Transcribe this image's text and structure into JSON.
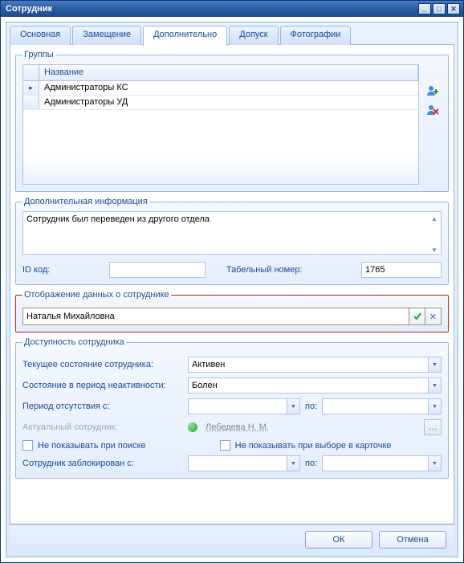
{
  "window": {
    "title": "Сотрудник"
  },
  "tabs": {
    "main": "Основная",
    "substitution": "Замещение",
    "additional": "Дополнительно",
    "access": "Допуск",
    "photos": "Фотографии"
  },
  "groups": {
    "legend": "Группы",
    "header": "Название",
    "rows": [
      "Администраторы КС",
      "Администраторы УД"
    ]
  },
  "addinfo": {
    "legend": "Дополнительная информация",
    "text": "Сотрудник был переведен из другого отдела",
    "idcode_label": "ID код:",
    "idcode_value": "",
    "tabnum_label": "Табельный номер:",
    "tabnum_value": "1765"
  },
  "display": {
    "legend": "Отображение данных о сотруднике",
    "value": "Наталья Михайловна"
  },
  "availability": {
    "legend": "Доступность сотрудника",
    "state_label": "Текущее состояние сотрудника:",
    "state_value": "Активен",
    "inactive_label": "Состояние в период неактивности:",
    "inactive_value": "Болен",
    "absent_label": "Период отсутствия с:",
    "absent_from": "",
    "to_label": "по:",
    "absent_to": "",
    "actual_label": "Актуальный сотрудник:",
    "actual_value": "Лебедева Н. М.",
    "hide_search_label": "Не показывать при поиске",
    "hide_card_label": "Не показывать при выборе в карточке",
    "blocked_label": "Сотрудник заблокирован с:",
    "blocked_from": "",
    "blocked_to": ""
  },
  "buttons": {
    "ok": "ОК",
    "cancel": "Отмена"
  }
}
